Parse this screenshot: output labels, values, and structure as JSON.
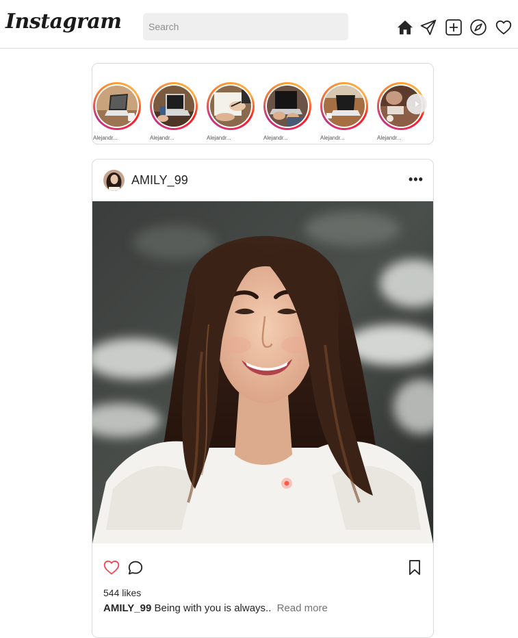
{
  "header": {
    "logo": "Instagram",
    "search_placeholder": "Search",
    "icons": [
      "home-icon",
      "send-icon",
      "new-post-icon",
      "explore-icon",
      "activity-heart-icon"
    ]
  },
  "stories": {
    "items": [
      {
        "name": "Alejandr...",
        "thumb": "laptop-desk"
      },
      {
        "name": "Alejandr...",
        "thumb": "laptop-hands-phone"
      },
      {
        "name": "Alejandr...",
        "thumb": "hands-writing"
      },
      {
        "name": "Alejandr...",
        "thumb": "laptop-typing"
      },
      {
        "name": "Alejandr...",
        "thumb": "laptop-wood-desk"
      },
      {
        "name": "Alejandr...",
        "thumb": "person-working"
      }
    ],
    "next_icon": "chevron-right-icon",
    "ring_colors": [
      "#f9a23a",
      "#fd1d1d",
      "#e1306c",
      "#c13584"
    ]
  },
  "post": {
    "username": "AMILY_99",
    "options_label": "•••",
    "likes_text": "544 likes",
    "caption_user": "AMILY_99",
    "caption_text": "Being with you is always..",
    "read_more": "Read more",
    "icons": [
      "like-heart-icon",
      "comment-icon",
      "bookmark-icon"
    ],
    "like_color": "#ed4956"
  }
}
